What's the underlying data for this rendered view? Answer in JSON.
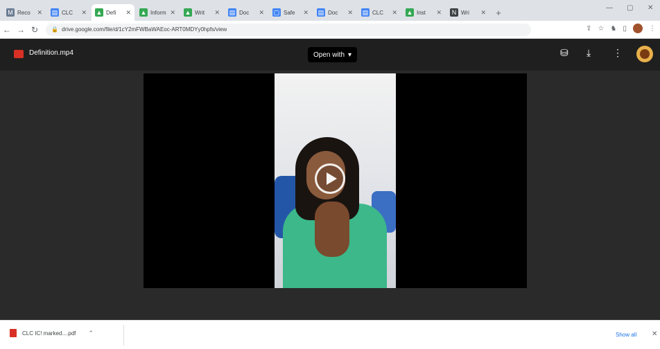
{
  "browser": {
    "tabs": [
      {
        "title": "Reco",
        "color": "#6b7c93",
        "glyph": "M"
      },
      {
        "title": "CLC",
        "color": "#4285f4",
        "glyph": "▤"
      },
      {
        "title": "Defi",
        "color": "#34a853",
        "glyph": "▲",
        "active": true
      },
      {
        "title": "Inform",
        "color": "#34a853",
        "glyph": "▲"
      },
      {
        "title": "Writ",
        "color": "#34a853",
        "glyph": "▲"
      },
      {
        "title": "Doc",
        "color": "#4285f4",
        "glyph": "▤"
      },
      {
        "title": "Safe",
        "color": "#4285f4",
        "glyph": "▢"
      },
      {
        "title": "Doc",
        "color": "#4285f4",
        "glyph": "▤"
      },
      {
        "title": "CLC",
        "color": "#4285f4",
        "glyph": "▤"
      },
      {
        "title": "Inst",
        "color": "#34a853",
        "glyph": "▲"
      },
      {
        "title": "Wri",
        "color": "#3c4043",
        "glyph": "N"
      }
    ],
    "url": "drive.google.com/file/d/1cY2mFWBaWAEoc-ART0MDYy0hpfs/view"
  },
  "viewer": {
    "filename": "Definition.mp4",
    "open_with_label": "Open with",
    "icons": [
      "add-to-drive-icon",
      "download-icon",
      "more-vert-icon"
    ]
  },
  "downloads": {
    "file_label": "CLC IC! marked....pdf",
    "show_all_label": "Show all"
  },
  "colors": {
    "viewer_bg": "#2a2a2a",
    "topbar_bg": "#1f1f1f",
    "accent": "#1a73e8",
    "pdf_red": "#d93025"
  }
}
